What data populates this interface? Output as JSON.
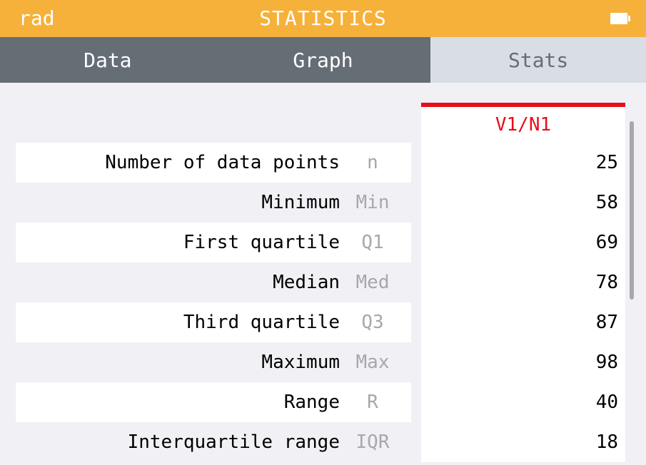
{
  "titlebar": {
    "angle_mode": "rad",
    "title": "STATISTICS",
    "battery": "battery-icon"
  },
  "tabs": [
    {
      "label": "Data",
      "active": false
    },
    {
      "label": "Graph",
      "active": false
    },
    {
      "label": "Stats",
      "active": true
    }
  ],
  "column_header": "V1/N1",
  "rows": [
    {
      "name": "Number of data points",
      "symbol": "n",
      "value": "25"
    },
    {
      "name": "Minimum",
      "symbol": "Min",
      "value": "58"
    },
    {
      "name": "First quartile",
      "symbol": "Q1",
      "value": "69"
    },
    {
      "name": "Median",
      "symbol": "Med",
      "value": "78"
    },
    {
      "name": "Third quartile",
      "symbol": "Q3",
      "value": "87"
    },
    {
      "name": "Maximum",
      "symbol": "Max",
      "value": "98"
    },
    {
      "name": "Range",
      "symbol": "R",
      "value": "40"
    },
    {
      "name": "Interquartile range",
      "symbol": "IQR",
      "value": "18"
    }
  ],
  "colors": {
    "titlebar": "#f6b13a",
    "tabs": "#656d75",
    "active_tab": "#d9dde4",
    "header_accent": "#e90d17"
  }
}
